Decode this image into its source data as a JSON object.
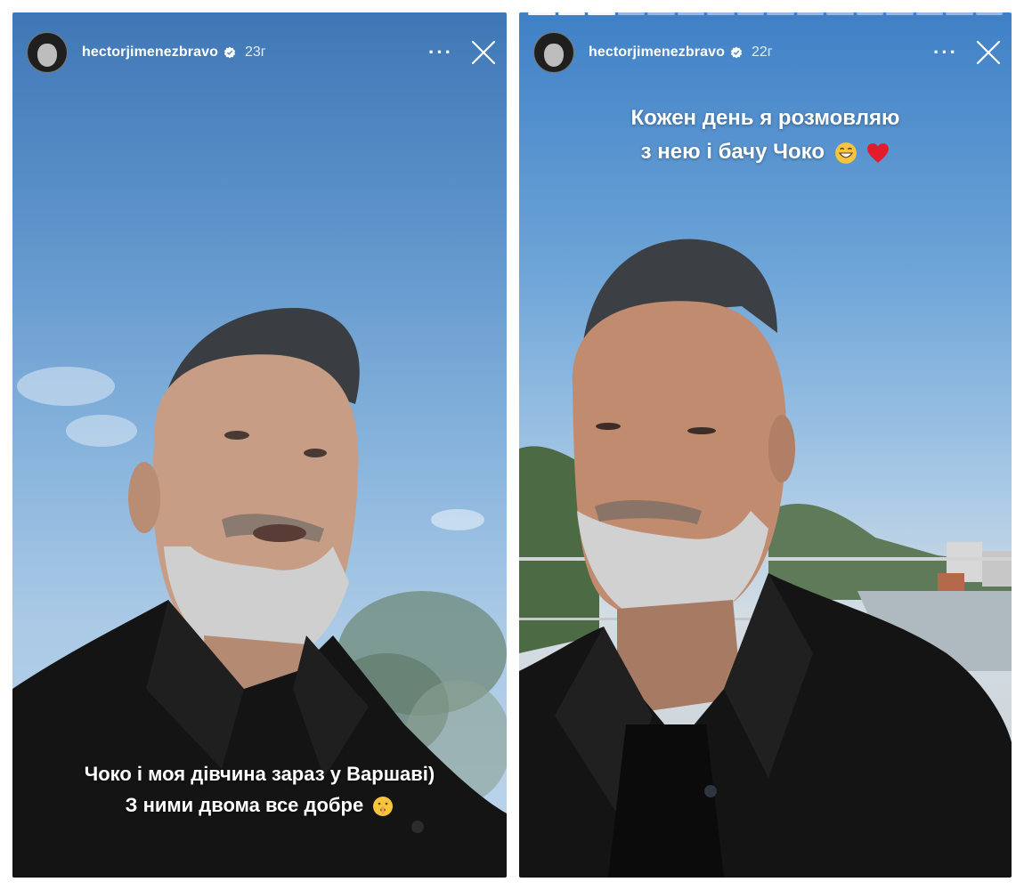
{
  "stories": [
    {
      "username": "hectorjimenezbravo",
      "time": "23г",
      "more_label": "···",
      "caption_line1": "Чоко і моя дівчина зараз у Варшаві)",
      "caption_line2": "З ними двома все добре",
      "emoji": "shushing-face-emoji"
    },
    {
      "username": "hectorjimenezbravo",
      "time": "22г",
      "more_label": "···",
      "caption_line1": "Кожен день я розмовляю",
      "caption_line2": "з нею і бачу Чоко",
      "emoji": "grinning-face-emoji, red-heart-emoji"
    }
  ],
  "colors": {
    "text": "#ffffff",
    "verified_badge": "#ffffff",
    "shirt": "#141414"
  },
  "icons": [
    "verified-badge-icon",
    "more-options-icon",
    "close-icon"
  ]
}
